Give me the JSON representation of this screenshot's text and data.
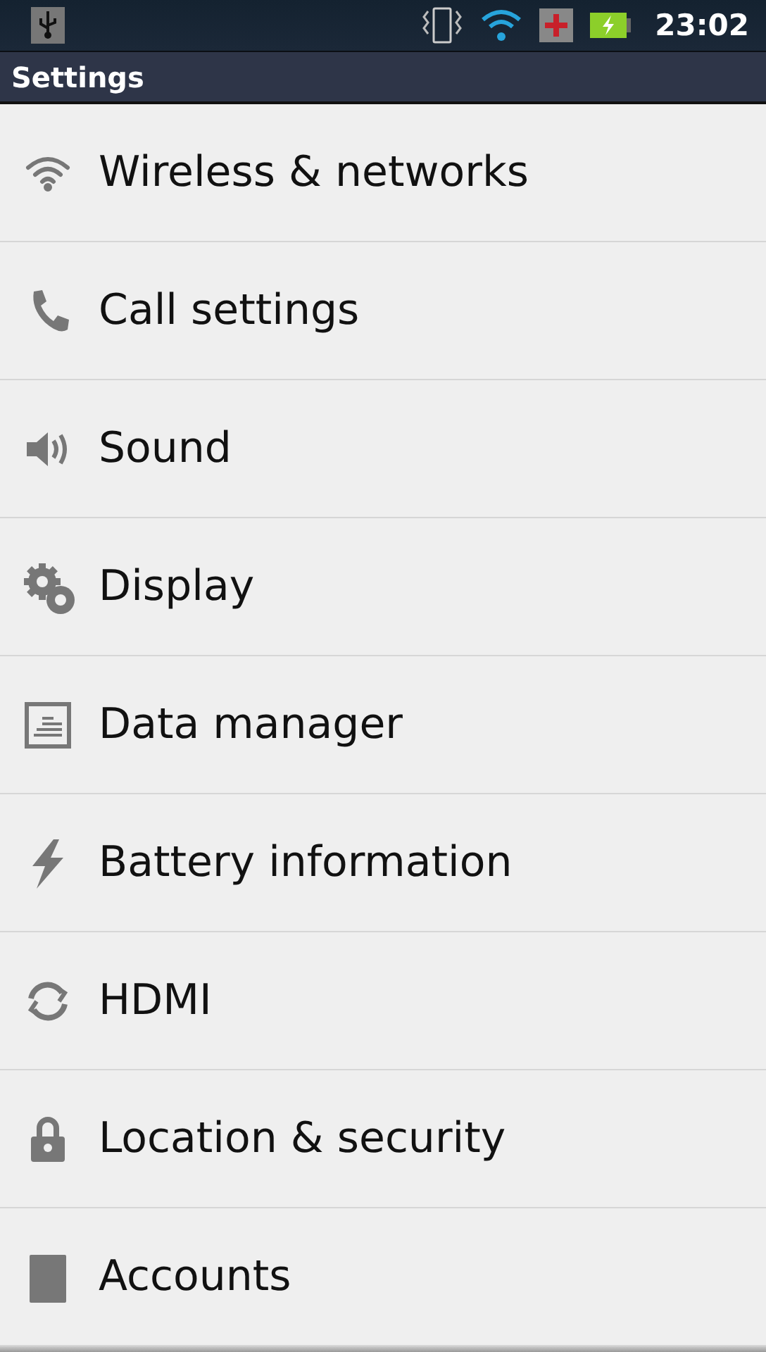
{
  "status_bar": {
    "time": "23:02"
  },
  "title_bar": {
    "title": "Settings"
  },
  "items": [
    {
      "label": "Wireless & networks"
    },
    {
      "label": "Call settings"
    },
    {
      "label": "Sound"
    },
    {
      "label": "Display"
    },
    {
      "label": "Data manager"
    },
    {
      "label": "Battery information"
    },
    {
      "label": "HDMI"
    },
    {
      "label": "Location & security"
    },
    {
      "label": "Accounts"
    }
  ]
}
